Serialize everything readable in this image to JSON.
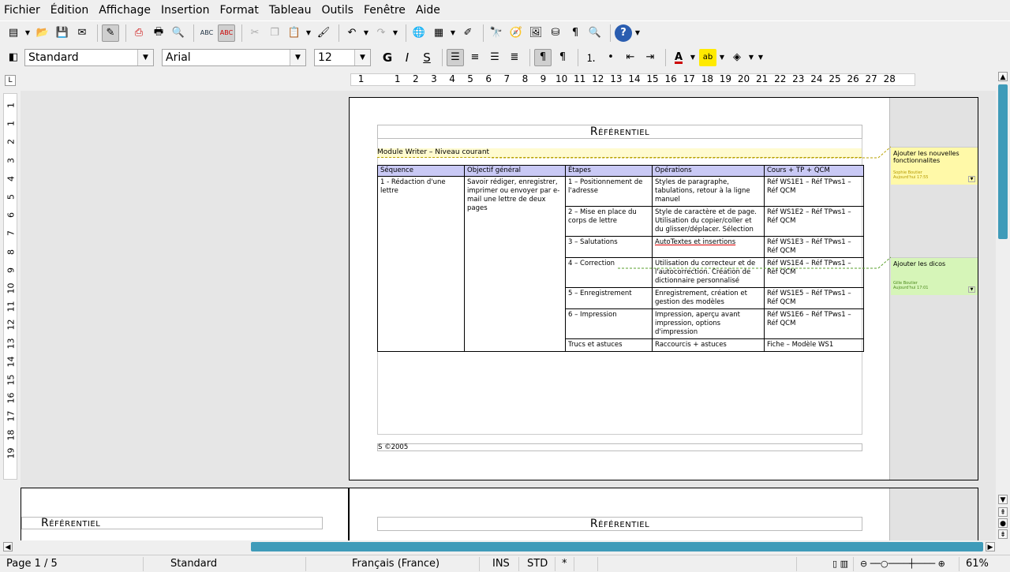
{
  "menu": [
    {
      "label": "Fichier"
    },
    {
      "label": "Édition"
    },
    {
      "label": "Affichage"
    },
    {
      "label": "Insertion"
    },
    {
      "label": "Format"
    },
    {
      "label": "Tableau"
    },
    {
      "label": "Outils"
    },
    {
      "label": "Fenêtre"
    },
    {
      "label": "Aide"
    }
  ],
  "format_bar": {
    "style": "Standard",
    "font": "Arial",
    "size": "12",
    "bold": "G",
    "italic": "I",
    "underline": "S"
  },
  "ruler": {
    "h_numbers": [
      "1",
      "",
      "1",
      "2",
      "3",
      "4",
      "5",
      "6",
      "7",
      "8",
      "9",
      "10",
      "11",
      "12",
      "13",
      "14",
      "15",
      "16",
      "17",
      "18",
      "19",
      "20",
      "21",
      "22",
      "23",
      "24",
      "25",
      "26",
      "27",
      "28"
    ],
    "v_numbers": [
      "1",
      "1",
      "2",
      "3",
      "4",
      "5",
      "6",
      "7",
      "8",
      "9",
      "10",
      "11",
      "12",
      "13",
      "14",
      "15",
      "16",
      "17",
      "18",
      "19"
    ]
  },
  "document": {
    "header_title": "Référentiel",
    "module_line": "Module Writer – Niveau courant",
    "table": {
      "headers": [
        "Séquence",
        "Objectif général",
        "Étapes",
        "Opérations",
        "Cours + TP + QCM"
      ],
      "sequence": "1 - Rédaction d'une lettre",
      "objective": "Savoir rédiger, enregistrer, imprimer ou envoyer par e-mail une lettre de deux pages",
      "rows": [
        {
          "step": "1 – Positionnement de l'adresse",
          "ops": "Styles de paragraphe, tabulations, retour à la ligne manuel",
          "ref": "Réf WS1E1 – Réf TPws1 – Réf QCM"
        },
        {
          "step": "2 – Mise en place du corps de lettre",
          "ops": "Style de caractère et de page. Utilisation du copier/coller et du glisser/déplacer. Sélection",
          "ref": "Réf WS1E2 – Réf TPws1 – Réf QCM"
        },
        {
          "step": "3 – Salutations",
          "ops": "AutoTextes et insertions",
          "ref": "Réf WS1E3 – Réf TPws1 – Réf QCM"
        },
        {
          "step": "4 – Correction",
          "ops": "Utilisation du correcteur et de l'autocorrection. Création de dictionnaire personnalisé",
          "ref": "Réf WS1E4 – Réf TPws1 – Réf QCM"
        },
        {
          "step": "5 – Enregistrement",
          "ops": "Enregistrement, création et gestion des modèles",
          "ref": "Réf WS1E5 – Réf TPws1 – Réf QCM"
        },
        {
          "step": "6 – Impression",
          "ops": "Impression, aperçu avant impression,  options d'impression",
          "ref": "Réf WS1E6 – Réf TPws1 – Réf QCM"
        },
        {
          "step": "Trucs et astuces",
          "ops": "Raccourcis + astuces",
          "ref": "Fiche – Modèle WS1"
        }
      ]
    },
    "footer_text": "S ©2005",
    "comments": [
      {
        "text": "Ajouter les nouvelles fonctionnalites",
        "author": "Sophie Boutier",
        "time": "Aujourd'hui 17:55",
        "color": "#fff9a8"
      },
      {
        "text": "Ajouter les dicos",
        "author": "Gille Boutier",
        "time": "Aujourd'hui 17:01",
        "color": "#d6f5b8"
      }
    ]
  },
  "status": {
    "page": "Page 1 / 5",
    "style": "Standard",
    "language": "Français (France)",
    "ins": "INS",
    "std": "STD",
    "modified": "*",
    "zoom": "61%"
  }
}
